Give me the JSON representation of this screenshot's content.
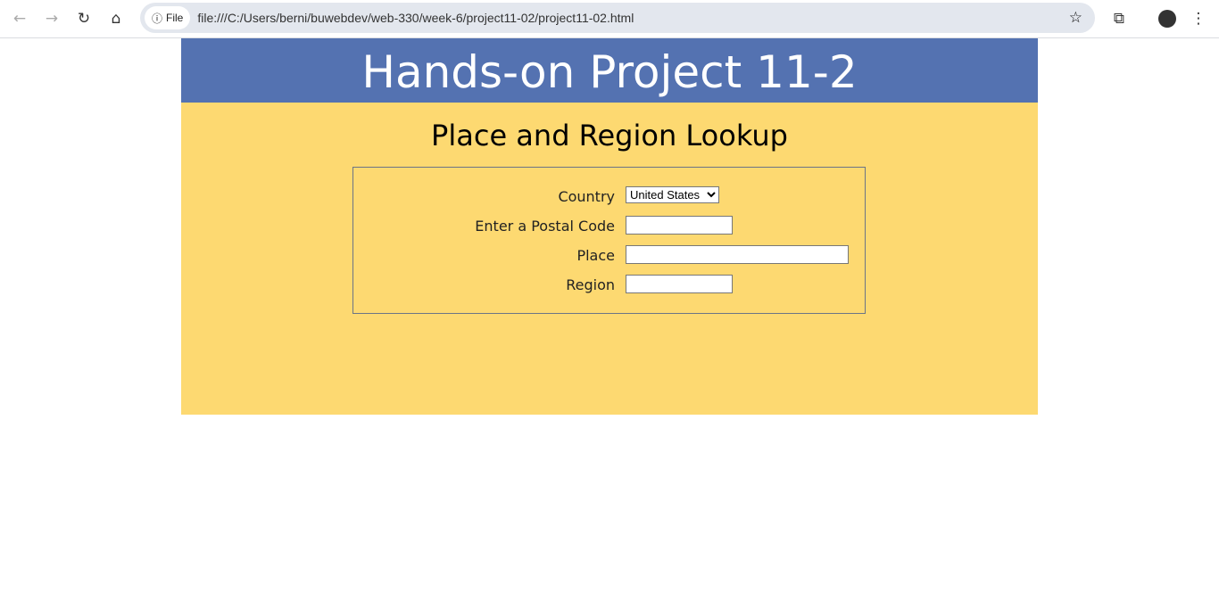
{
  "browser": {
    "chip_label": "File",
    "url": "file:///C:/Users/berni/buwebdev/web-330/week-6/project11-02/project11-02.html"
  },
  "page": {
    "banner": "Hands-on Project 11-2",
    "heading": "Place and Region Lookup"
  },
  "form": {
    "country_label": "Country",
    "country_value": "United States",
    "postal_label": "Enter a Postal Code",
    "postal_value": "",
    "place_label": "Place",
    "place_value": "",
    "region_label": "Region",
    "region_value": ""
  }
}
